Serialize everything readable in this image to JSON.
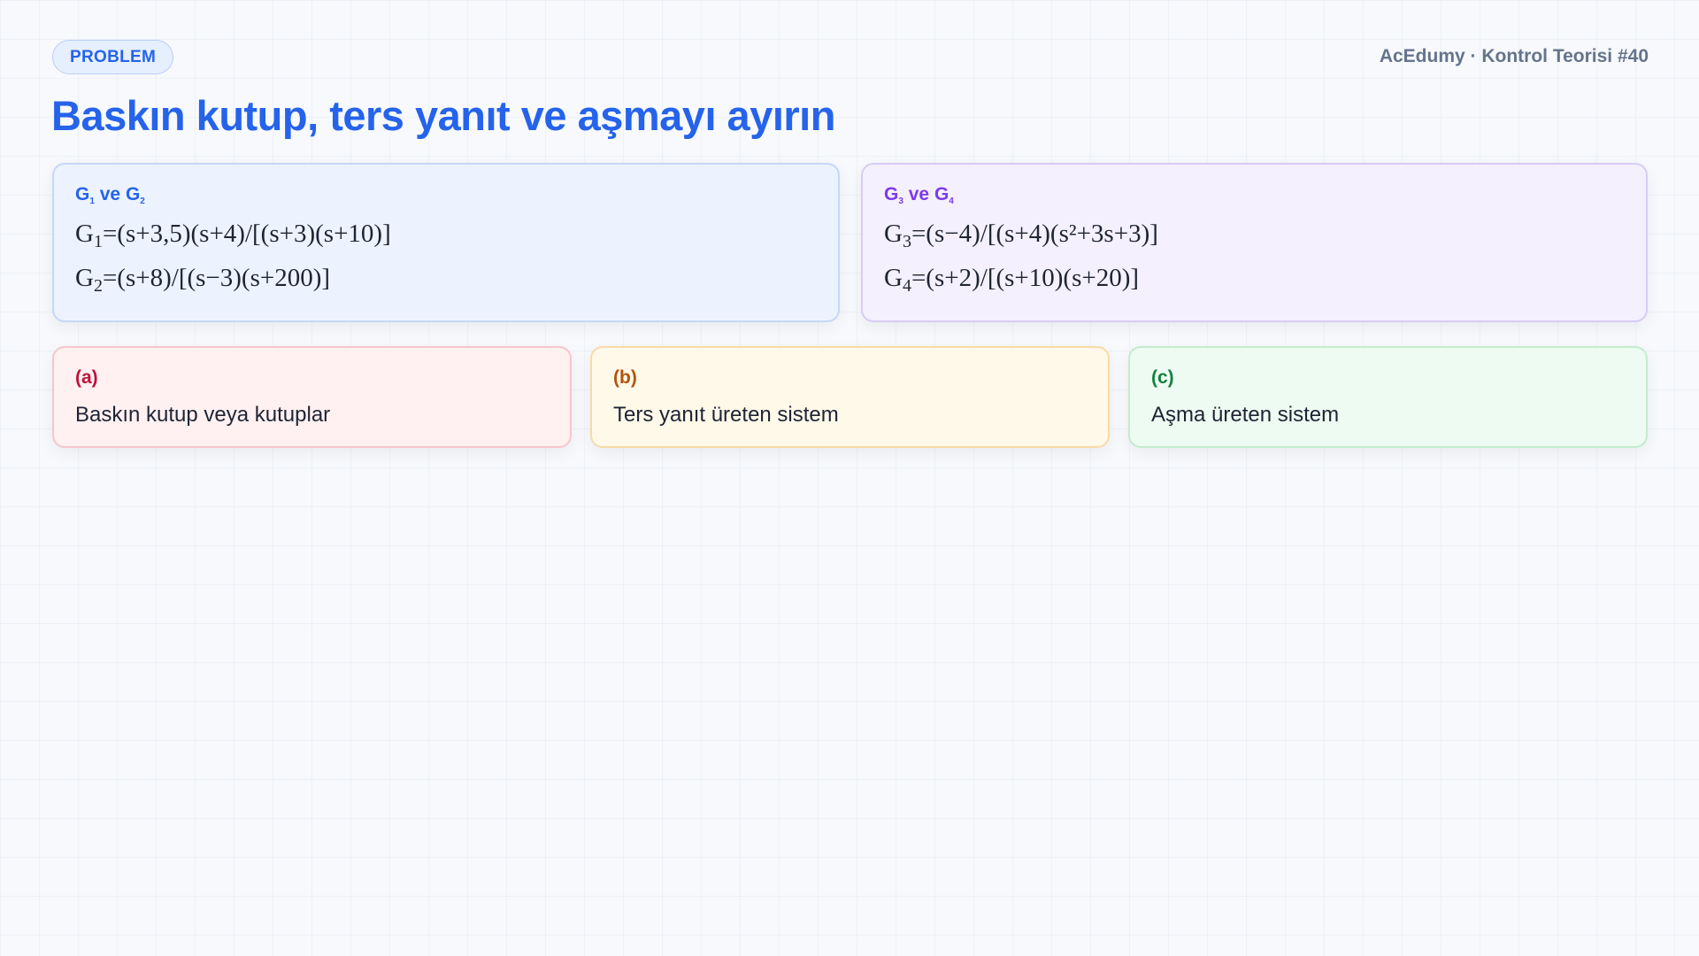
{
  "header": {
    "badge": "PROBLEM",
    "brand": "AcEdumy · Kontrol Teorisi #40",
    "title": "Baskın kutup, ters yanıt ve aşmayı ayırın"
  },
  "systems": [
    {
      "heading": {
        "g1": "G",
        "s1": "1",
        "mid": " ve ",
        "g2": "G",
        "s2": "2"
      },
      "equations": [
        {
          "name": "G",
          "sub": "1",
          "expr": "=(s+3,5)(s+4)/[(s+3)(s+10)]"
        },
        {
          "name": "G",
          "sub": "2",
          "expr": "=(s+8)/[(s−3)(s+200)]"
        }
      ],
      "color": "#2563eb"
    },
    {
      "heading": {
        "g1": "G",
        "s1": "3",
        "mid": " ve ",
        "g2": "G",
        "s2": "4"
      },
      "equations": [
        {
          "name": "G",
          "sub": "3",
          "expr": "=(s−4)/[(s+4)(s²+3s+3)]"
        },
        {
          "name": "G",
          "sub": "4",
          "expr": "=(s+2)/[(s+10)(s+20)]"
        }
      ],
      "color": "#7c3aed"
    }
  ],
  "questions": [
    {
      "tag": "(a)",
      "text": "Baskın kutup veya kutuplar",
      "color": "#be123c"
    },
    {
      "tag": "(b)",
      "text": "Ters yanıt üreten sistem",
      "color": "#b45309"
    },
    {
      "tag": "(c)",
      "text": "Aşma üreten sistem",
      "color": "#15803d"
    }
  ]
}
